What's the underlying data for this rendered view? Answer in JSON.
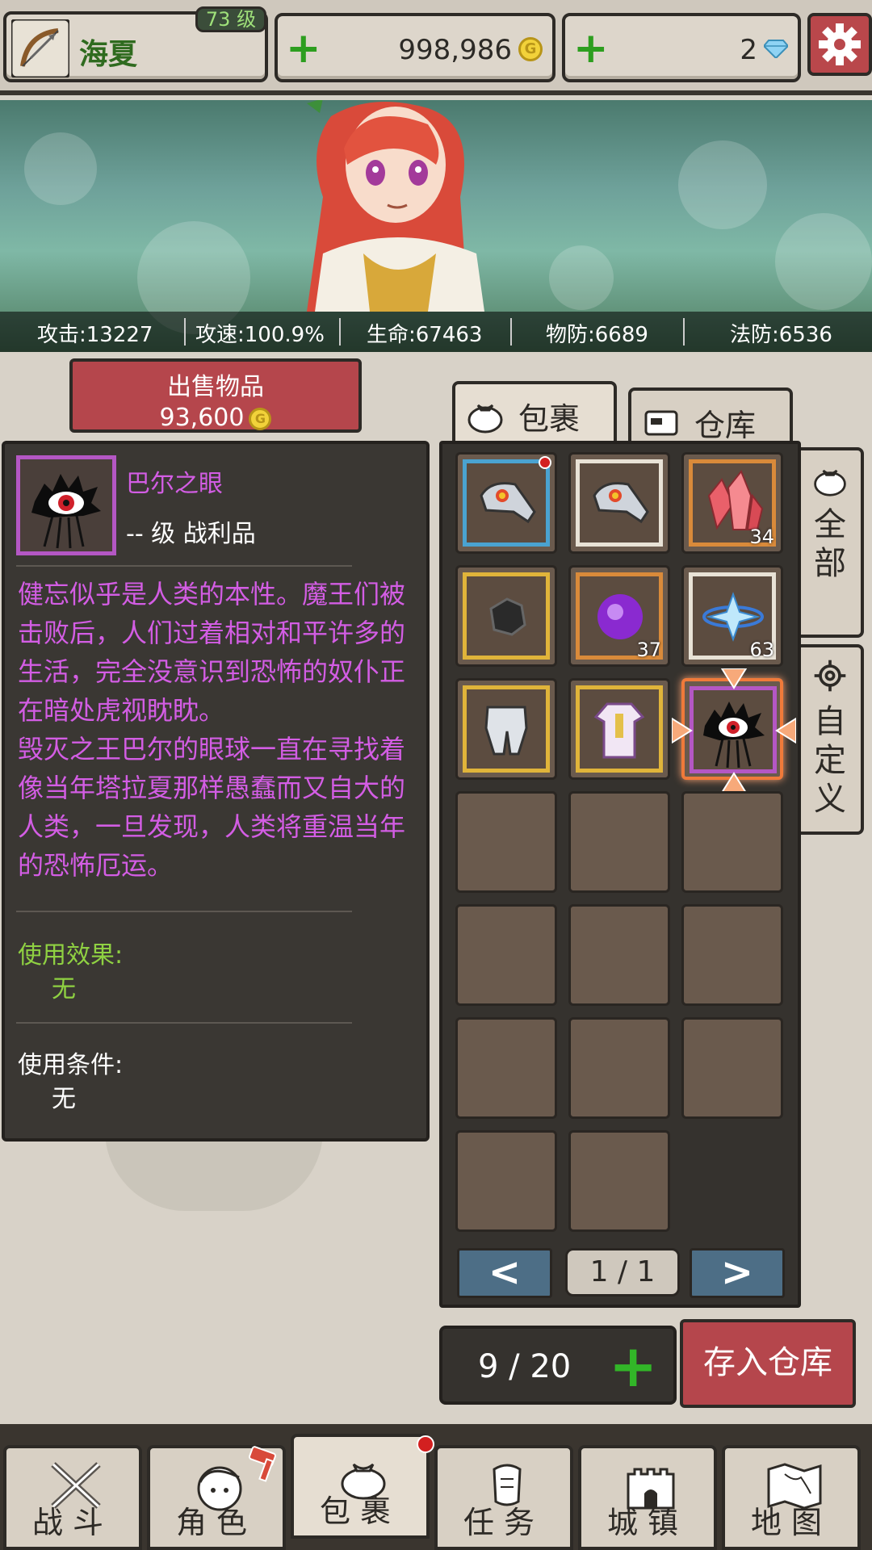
{
  "header": {
    "character_name": "海夏",
    "level": "73 级",
    "gold": "998,986",
    "gold_icon": "G",
    "gems": "2"
  },
  "stats": [
    {
      "label": "攻击:13227"
    },
    {
      "label": "攻速:100.9%"
    },
    {
      "label": "生命:67463"
    },
    {
      "label": "物防:6689"
    },
    {
      "label": "法防:6536"
    }
  ],
  "sell": {
    "label": "出售物品",
    "price": "93,600",
    "coin_icon": "G"
  },
  "item_detail": {
    "name": "巴尔之眼",
    "level_text": "-- 级 战利品",
    "description": "健忘似乎是人类的本性。魔王们被击败后，人们过着相对和平许多的生活，完全没意识到恐怖的奴仆正在暗处虎视眈眈。\n毁灭之王巴尔的眼球一直在寻找着像当年塔拉夏那样愚蠢而又自大的人类，一旦发现，人类将重温当年的恐怖厄运。",
    "effect_title": "使用效果:",
    "effect_value": "无",
    "condition_title": "使用条件:",
    "condition_value": "无",
    "name_color": "#d35de4",
    "effect_title_color": "#8fd142"
  },
  "tabs": {
    "bag": "包裹",
    "storage": "仓库"
  },
  "side_tabs": {
    "all": [
      "全",
      "部"
    ],
    "custom": [
      "自",
      "定",
      "义"
    ]
  },
  "inventory": [
    {
      "icon": "armor-gauntlet-icon",
      "border": "#4aa3d1",
      "qty": "",
      "new": true
    },
    {
      "icon": "armor-gauntlet-icon",
      "border": "#e8e2d6",
      "qty": "",
      "new": false
    },
    {
      "icon": "red-crystal-icon",
      "border": "#d98a3a",
      "qty": "34",
      "new": false
    },
    {
      "icon": "coal-ore-icon",
      "border": "#e0b43a",
      "qty": "",
      "new": false
    },
    {
      "icon": "purple-orb-icon",
      "border": "#d98a3a",
      "qty": "37",
      "new": false
    },
    {
      "icon": "ice-crystal-icon",
      "border": "#e8e2d6",
      "qty": "63",
      "new": false
    },
    {
      "icon": "steel-greaves-icon",
      "border": "#e0b43a",
      "qty": "",
      "new": false
    },
    {
      "icon": "robe-armor-icon",
      "border": "#e0b43a",
      "qty": "",
      "new": false
    },
    {
      "icon": "eye-of-baal-icon",
      "border": "#b457c4",
      "qty": "",
      "new": false,
      "selected": true
    }
  ],
  "pagination": {
    "text": "1 / 1",
    "prev": "<",
    "next": ">"
  },
  "capacity": {
    "text": "9 / 20",
    "plus": "+"
  },
  "store_button": "存入仓库",
  "nav": [
    {
      "label": "战斗",
      "icon": "crossed-swords-icon"
    },
    {
      "label": "角色",
      "icon": "character-face-icon"
    },
    {
      "label": "包裹",
      "icon": "bag-icon"
    },
    {
      "label": "任务",
      "icon": "quest-icon"
    },
    {
      "label": "城镇",
      "icon": "castle-icon"
    },
    {
      "label": "地图",
      "icon": "map-icon"
    }
  ],
  "colors": {
    "accent_red": "#b5464c",
    "grid_bg": "#35322e",
    "gold_green": "#2d9e1f"
  }
}
